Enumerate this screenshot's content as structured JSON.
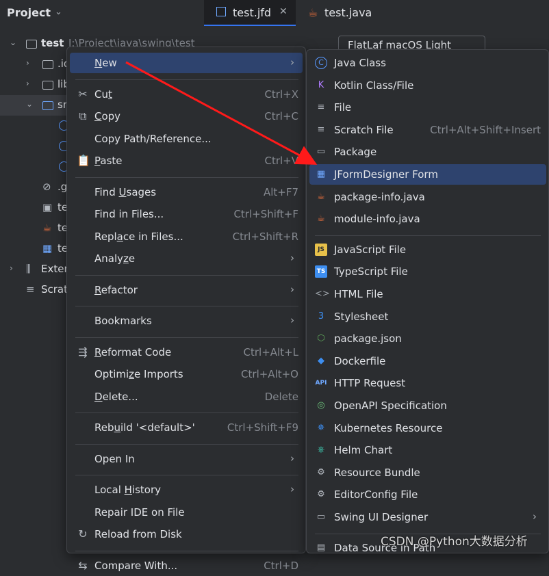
{
  "project_panel": {
    "title": "Project",
    "tree": [
      {
        "label": "test",
        "path": "I:\\Project\\java\\swing\\test",
        "arrow": "⌄",
        "icon": "module-folder-icon"
      },
      {
        "label": ".id",
        "arrow": "›",
        "icon": "folder-icon"
      },
      {
        "label": "lib",
        "arrow": "›",
        "icon": "folder-icon"
      },
      {
        "label": "sr",
        "arrow": "⌄",
        "icon": "source-folder-icon"
      },
      {
        "label": "",
        "icon": "java-class-icon"
      },
      {
        "label": "",
        "icon": "java-class-icon"
      },
      {
        "label": "",
        "icon": "java-class-icon"
      },
      {
        "label": ".g",
        "icon": "gitignore-icon"
      },
      {
        "label": "te",
        "icon": "text-file-icon"
      },
      {
        "label": "te",
        "icon": "java-file-icon"
      },
      {
        "label": "te",
        "icon": "form-file-icon"
      },
      {
        "label": "Exter",
        "arrow": "›",
        "icon": "library-icon"
      },
      {
        "label": "Scrat",
        "icon": "scratch-icon"
      }
    ]
  },
  "tabs": [
    {
      "label": "test.jfd",
      "active": true,
      "icon": "form-file-icon"
    },
    {
      "label": "test.java",
      "active": false,
      "icon": "java-file-icon"
    }
  ],
  "look_and_feel": "FlatLaf macOS Light",
  "context_menu": {
    "items": [
      {
        "label": "New",
        "mnemonic": "N",
        "submenu": true,
        "highlight": true
      },
      {
        "sep": true
      },
      {
        "label": "Cut",
        "mnemonic": "t",
        "shortcut": "Ctrl+X",
        "icon": "scissors-icon"
      },
      {
        "label": "Copy",
        "mnemonic": "C",
        "shortcut": "Ctrl+C",
        "icon": "copy-icon"
      },
      {
        "label": "Copy Path/Reference...",
        "shortcut": ""
      },
      {
        "label": "Paste",
        "mnemonic": "P",
        "shortcut": "Ctrl+V",
        "icon": "paste-icon"
      },
      {
        "sep": true
      },
      {
        "label": "Find Usages",
        "mnemonic": "U",
        "shortcut": "Alt+F7"
      },
      {
        "label": "Find in Files...",
        "shortcut": "Ctrl+Shift+F"
      },
      {
        "label": "Replace in Files...",
        "mnemonic": "a",
        "shortcut": "Ctrl+Shift+R"
      },
      {
        "label": "Analyze",
        "mnemonic": "z",
        "submenu": true
      },
      {
        "sep": true
      },
      {
        "label": "Refactor",
        "mnemonic": "R",
        "submenu": true
      },
      {
        "sep": true
      },
      {
        "label": "Bookmarks",
        "submenu": true
      },
      {
        "sep": true
      },
      {
        "label": "Reformat Code",
        "mnemonic": "R",
        "shortcut": "Ctrl+Alt+L",
        "icon": "reformat-icon"
      },
      {
        "label": "Optimize Imports",
        "mnemonic": "z",
        "shortcut": "Ctrl+Alt+O"
      },
      {
        "label": "Delete...",
        "mnemonic": "D",
        "shortcut": "Delete"
      },
      {
        "sep": true
      },
      {
        "label": "Rebuild '<default>'",
        "mnemonic": "u",
        "shortcut": "Ctrl+Shift+F9"
      },
      {
        "sep": true
      },
      {
        "label": "Open In",
        "submenu": true
      },
      {
        "sep": true
      },
      {
        "label": "Local History",
        "mnemonic": "H",
        "submenu": true
      },
      {
        "label": "Repair IDE on File",
        "shortcut": ""
      },
      {
        "label": "Reload from Disk",
        "shortcut": "",
        "icon": "reload-icon"
      },
      {
        "sep": true
      },
      {
        "label": "Compare With...",
        "shortcut": "Ctrl+D",
        "icon": "compare-icon"
      }
    ]
  },
  "submenu": {
    "items": [
      {
        "label": "Java Class",
        "icon": "java-class-icon",
        "color": "#5898ff"
      },
      {
        "label": "Kotlin Class/File",
        "icon": "kotlin-icon",
        "color": "#b07cff"
      },
      {
        "label": "File",
        "icon": "file-icon",
        "color": "#b3b8bf"
      },
      {
        "label": "Scratch File",
        "shortcut": "Ctrl+Alt+Shift+Insert",
        "icon": "scratch-icon",
        "color": "#b3b8bf"
      },
      {
        "label": "Package",
        "icon": "package-icon",
        "color": "#b3b8bf"
      },
      {
        "label": "JFormDesigner Form",
        "icon": "form-file-icon",
        "color": "#6fa8ff",
        "highlight": true
      },
      {
        "label": "package-info.java",
        "icon": "java-file-icon",
        "color": "#e06c3c"
      },
      {
        "label": "module-info.java",
        "icon": "java-file-icon",
        "color": "#e06c3c"
      },
      {
        "sep": true
      },
      {
        "label": "JavaScript File",
        "icon": "javascript-icon",
        "color": "#e8c14a"
      },
      {
        "label": "TypeScript File",
        "icon": "typescript-icon",
        "color": "#3d8ef0"
      },
      {
        "label": "HTML File",
        "icon": "html-icon",
        "color": "#9aa0a6"
      },
      {
        "label": "Stylesheet",
        "icon": "css-icon",
        "color": "#3d8ef0"
      },
      {
        "label": "package.json",
        "icon": "nodejs-icon",
        "color": "#5fa85a"
      },
      {
        "label": "Dockerfile",
        "icon": "docker-icon",
        "color": "#3d8ef0"
      },
      {
        "label": "HTTP Request",
        "icon": "api-icon",
        "color": "#6fa8ff"
      },
      {
        "label": "OpenAPI Specification",
        "icon": "openapi-icon",
        "color": "#6cc07a"
      },
      {
        "label": "Kubernetes Resource",
        "icon": "kubernetes-icon",
        "color": "#3d8ef0"
      },
      {
        "label": "Helm Chart",
        "icon": "helm-icon",
        "color": "#3dc9b0"
      },
      {
        "label": "Resource Bundle",
        "icon": "resource-bundle-icon",
        "color": "#b3b8bf"
      },
      {
        "label": "EditorConfig File",
        "icon": "editorconfig-icon",
        "color": "#b3b8bf"
      },
      {
        "label": "Swing UI Designer",
        "icon": "swing-designer-icon",
        "color": "#b3b8bf",
        "submenu": true
      },
      {
        "sep": true
      },
      {
        "label": "Data Source in Path",
        "icon": "database-icon",
        "color": "#b3b8bf"
      }
    ]
  },
  "colors": {
    "background": "#2b2d30",
    "menu_highlight": "#2e436e",
    "annotation_arrow": "#ff1a1a"
  },
  "watermark": "CSDN @Python大数据分析"
}
